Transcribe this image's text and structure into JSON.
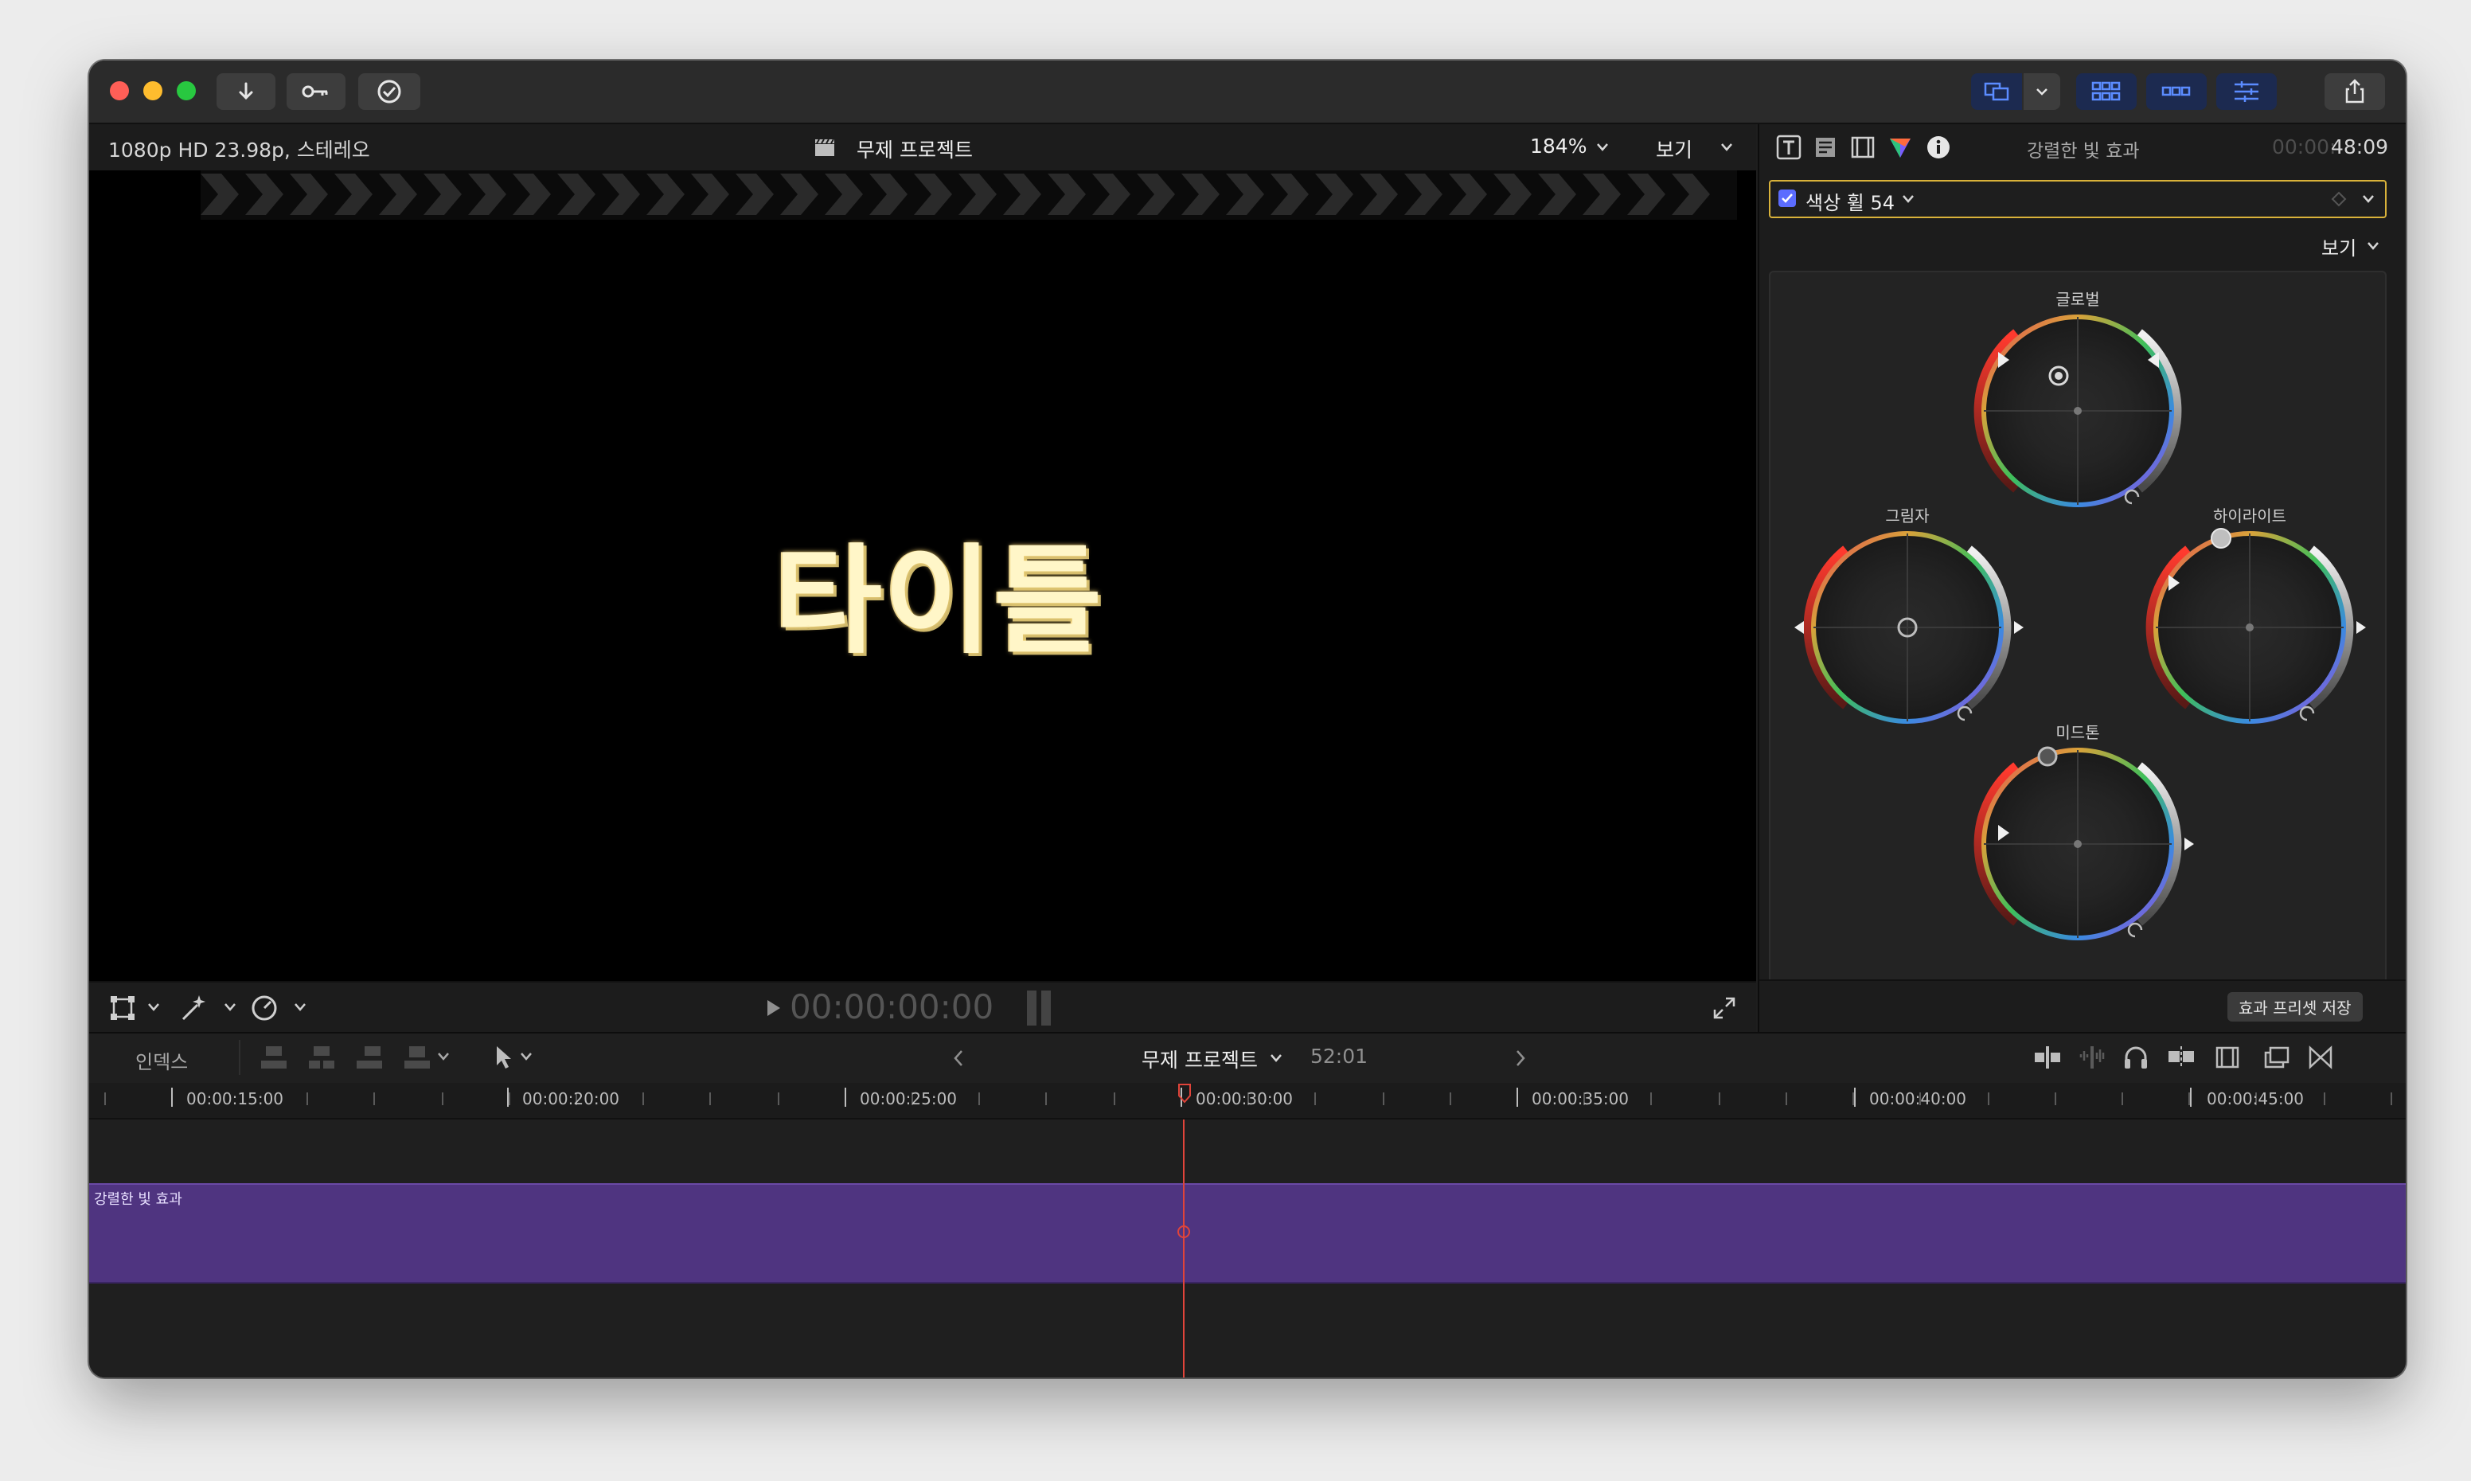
{
  "toolbar": {
    "traffic_lights": {
      "close": "#ff5f57",
      "minimize": "#febc2e",
      "zoom": "#28c840"
    },
    "left_icons": [
      "import-arrow-icon",
      "keyword-key-icon",
      "background-tasks-check-icon"
    ],
    "right_icons": [
      "window-layout-icon",
      "chevron-down-icon",
      "browser-grid-icon",
      "timeline-strip-icon",
      "inspector-sliders-icon",
      "share-icon"
    ]
  },
  "viewer": {
    "format_label": "1080p HD 23.98p, 스테레오",
    "project_name": "무제 프로젝트",
    "zoom": "184%",
    "view_menu": "보기",
    "title_text": "타이틀",
    "timecode": "00:00:00:00"
  },
  "inspector": {
    "title": "강렬한 빛 효과",
    "duration_dim": "00:00:",
    "duration": "48:09",
    "effect_name": "색상 휠 54",
    "view_menu": "보기",
    "wheels": {
      "global": "글로벌",
      "shadows": "그림자",
      "highlights": "하이라이트",
      "midtones": "미드톤"
    },
    "save_preset": "효과 프리셋 저장"
  },
  "timeline": {
    "index_label": "인덱스",
    "project_name": "무제 프로젝트",
    "duration": "52:01",
    "ruler_labels": [
      "00:00:15:00",
      "00:00:20:00",
      "00:00:25:00",
      "00:00:30:00",
      "00:00:35:00",
      "00:00:40:00",
      "00:00:45:00"
    ],
    "clip_label": "강렬한 빛 효과",
    "playhead_color": "#e0443a",
    "clip_color": "#4f3480"
  }
}
